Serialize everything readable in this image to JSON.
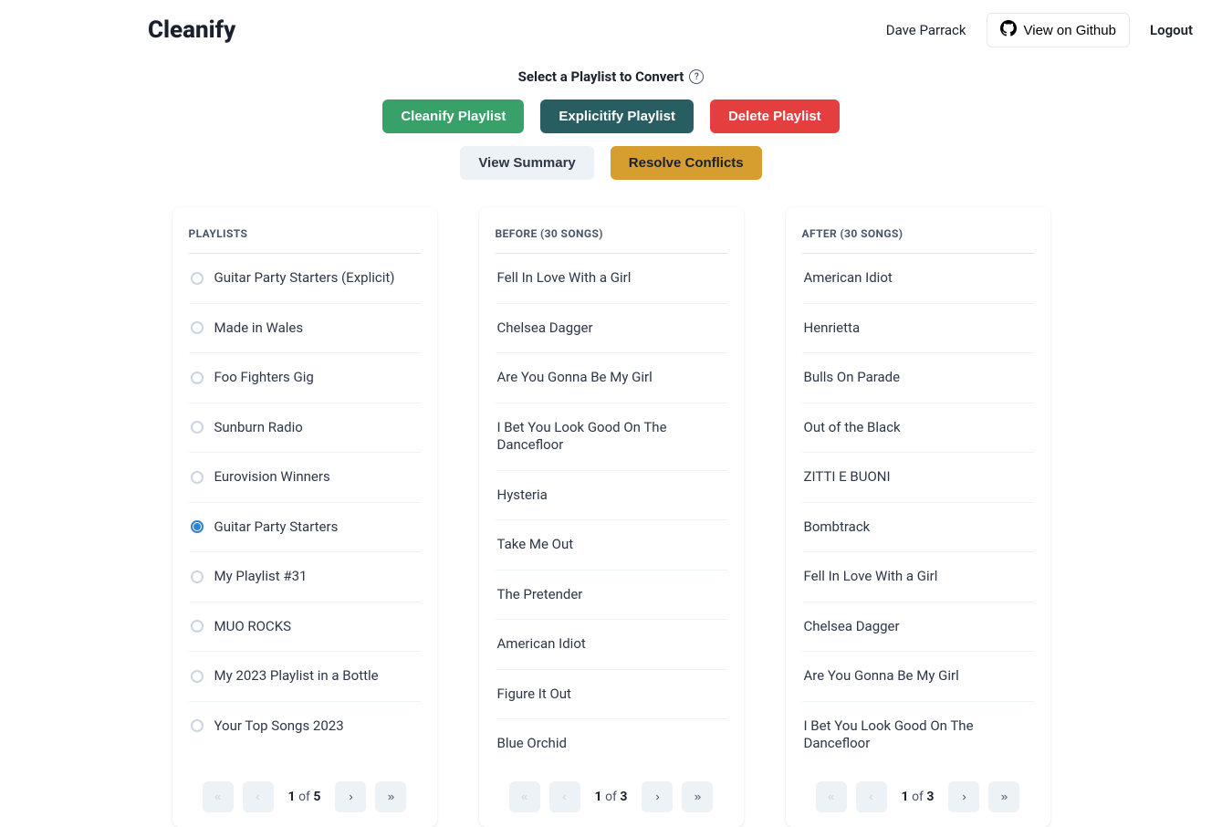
{
  "brand": "Cleanify",
  "user": "Dave Parrack",
  "github_label": "View on Github",
  "logout_label": "Logout",
  "heading": "Select a Playlist to Convert",
  "actions": {
    "cleanify": "Cleanify Playlist",
    "explicitify": "Explicitify Playlist",
    "delete": "Delete Playlist",
    "summary": "View Summary",
    "resolve": "Resolve Conflicts"
  },
  "playlists": {
    "header": "PLAYLISTS",
    "items": [
      {
        "label": "Guitar Party Starters (Explicit)",
        "selected": false
      },
      {
        "label": "Made in Wales",
        "selected": false
      },
      {
        "label": "Foo Fighters Gig",
        "selected": false
      },
      {
        "label": "Sunburn Radio",
        "selected": false
      },
      {
        "label": "Eurovision Winners",
        "selected": false
      },
      {
        "label": "Guitar Party Starters",
        "selected": true
      },
      {
        "label": "My Playlist #31",
        "selected": false
      },
      {
        "label": "MUO ROCKS",
        "selected": false
      },
      {
        "label": "My 2023 Playlist in a Bottle",
        "selected": false
      },
      {
        "label": "Your Top Songs 2023",
        "selected": false
      }
    ],
    "page_current": "1",
    "page_total": "5"
  },
  "before": {
    "header": "BEFORE (30 SONGS)",
    "items": [
      "Fell In Love With a Girl",
      "Chelsea Dagger",
      "Are You Gonna Be My Girl",
      "I Bet You Look Good On The Dancefloor",
      "Hysteria",
      "Take Me Out",
      "The Pretender",
      "American Idiot",
      "Figure It Out",
      "Blue Orchid"
    ],
    "page_current": "1",
    "page_total": "3"
  },
  "after": {
    "header": "AFTER (30 SONGS)",
    "items": [
      "American Idiot",
      "Henrietta",
      "Bulls On Parade",
      "Out of the Black",
      "ZITTI E BUONI",
      "Bombtrack",
      "Fell In Love With a Girl",
      "Chelsea Dagger",
      "Are You Gonna Be My Girl",
      "I Bet You Look Good On The Dancefloor"
    ],
    "page_current": "1",
    "page_total": "3"
  },
  "of_label": "of"
}
